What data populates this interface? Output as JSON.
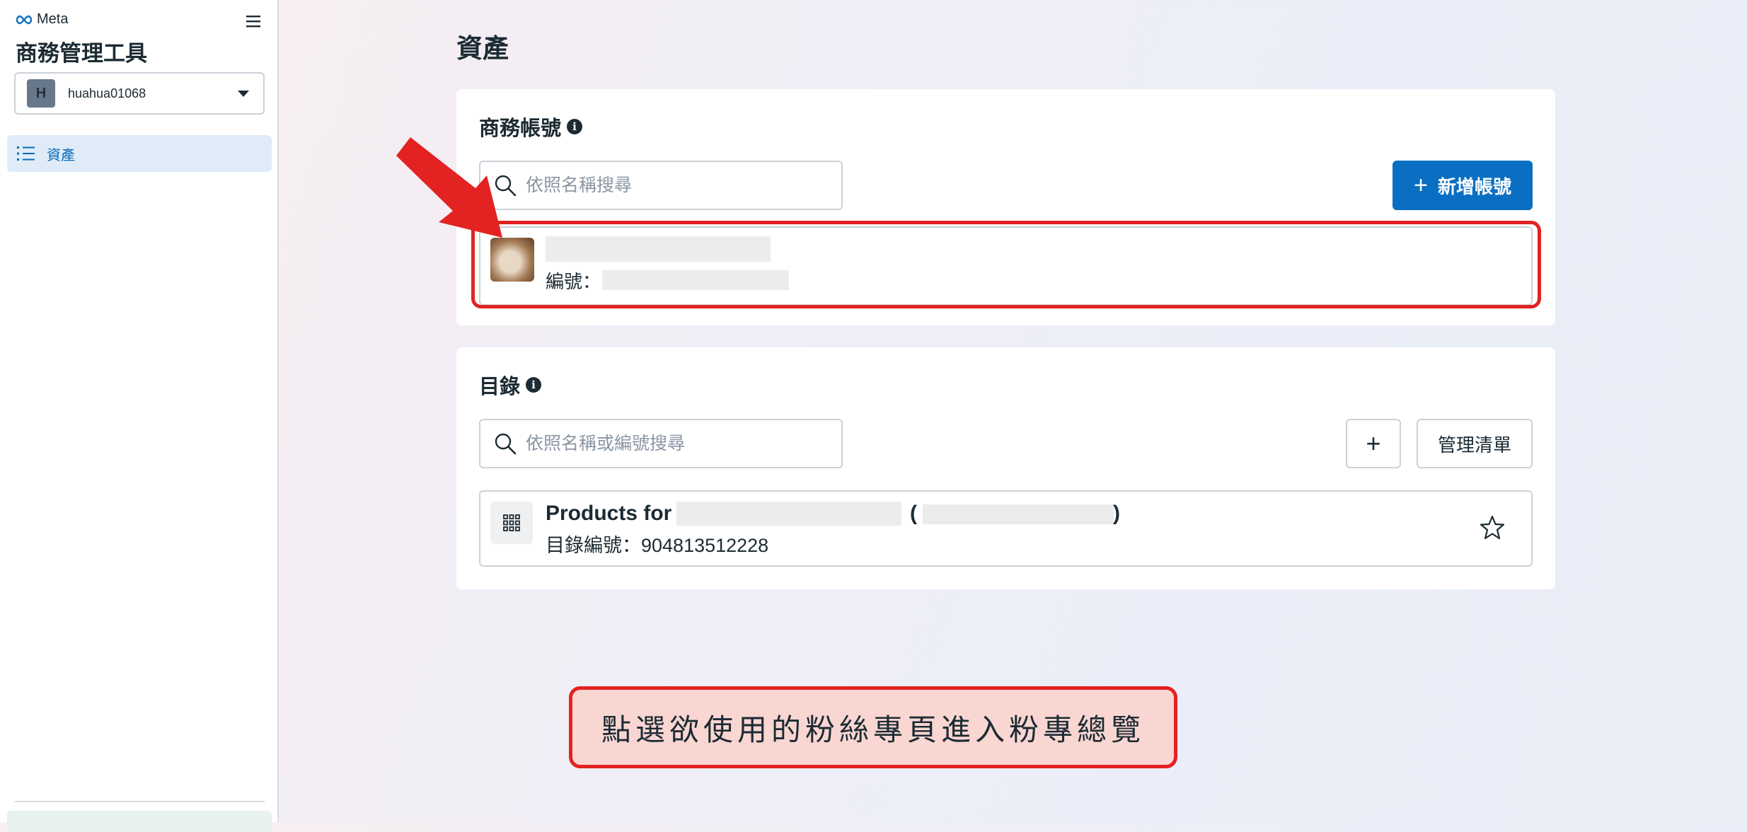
{
  "sidebar": {
    "brand": "Meta",
    "title": "商務管理工具",
    "account": {
      "initial": "H",
      "name": "huahua01068"
    },
    "nav_items": [
      {
        "label": "資產",
        "icon": "list-icon",
        "active": true
      }
    ]
  },
  "main": {
    "page_title": "資產",
    "business_accounts": {
      "title": "商務帳號",
      "search_placeholder": "依照名稱搜尋",
      "add_button": "新增帳號",
      "rows": [
        {
          "id_label": "編號："
        }
      ]
    },
    "catalogs": {
      "title": "目錄",
      "search_placeholder": "依照名稱或編號搜尋",
      "add_button": "+",
      "manage_button": "管理清單",
      "rows": [
        {
          "name_prefix": "Products for",
          "paren_open": "(",
          "paren_close": ")",
          "id_text": "目錄編號：904813512228"
        }
      ]
    }
  },
  "annotation": {
    "callout_text": "點選欲使用的粉絲專頁進入粉專總覽",
    "color": "#e32222"
  },
  "colors": {
    "accent": "#0a6fc2",
    "nav_active_bg": "#dfecf7"
  }
}
